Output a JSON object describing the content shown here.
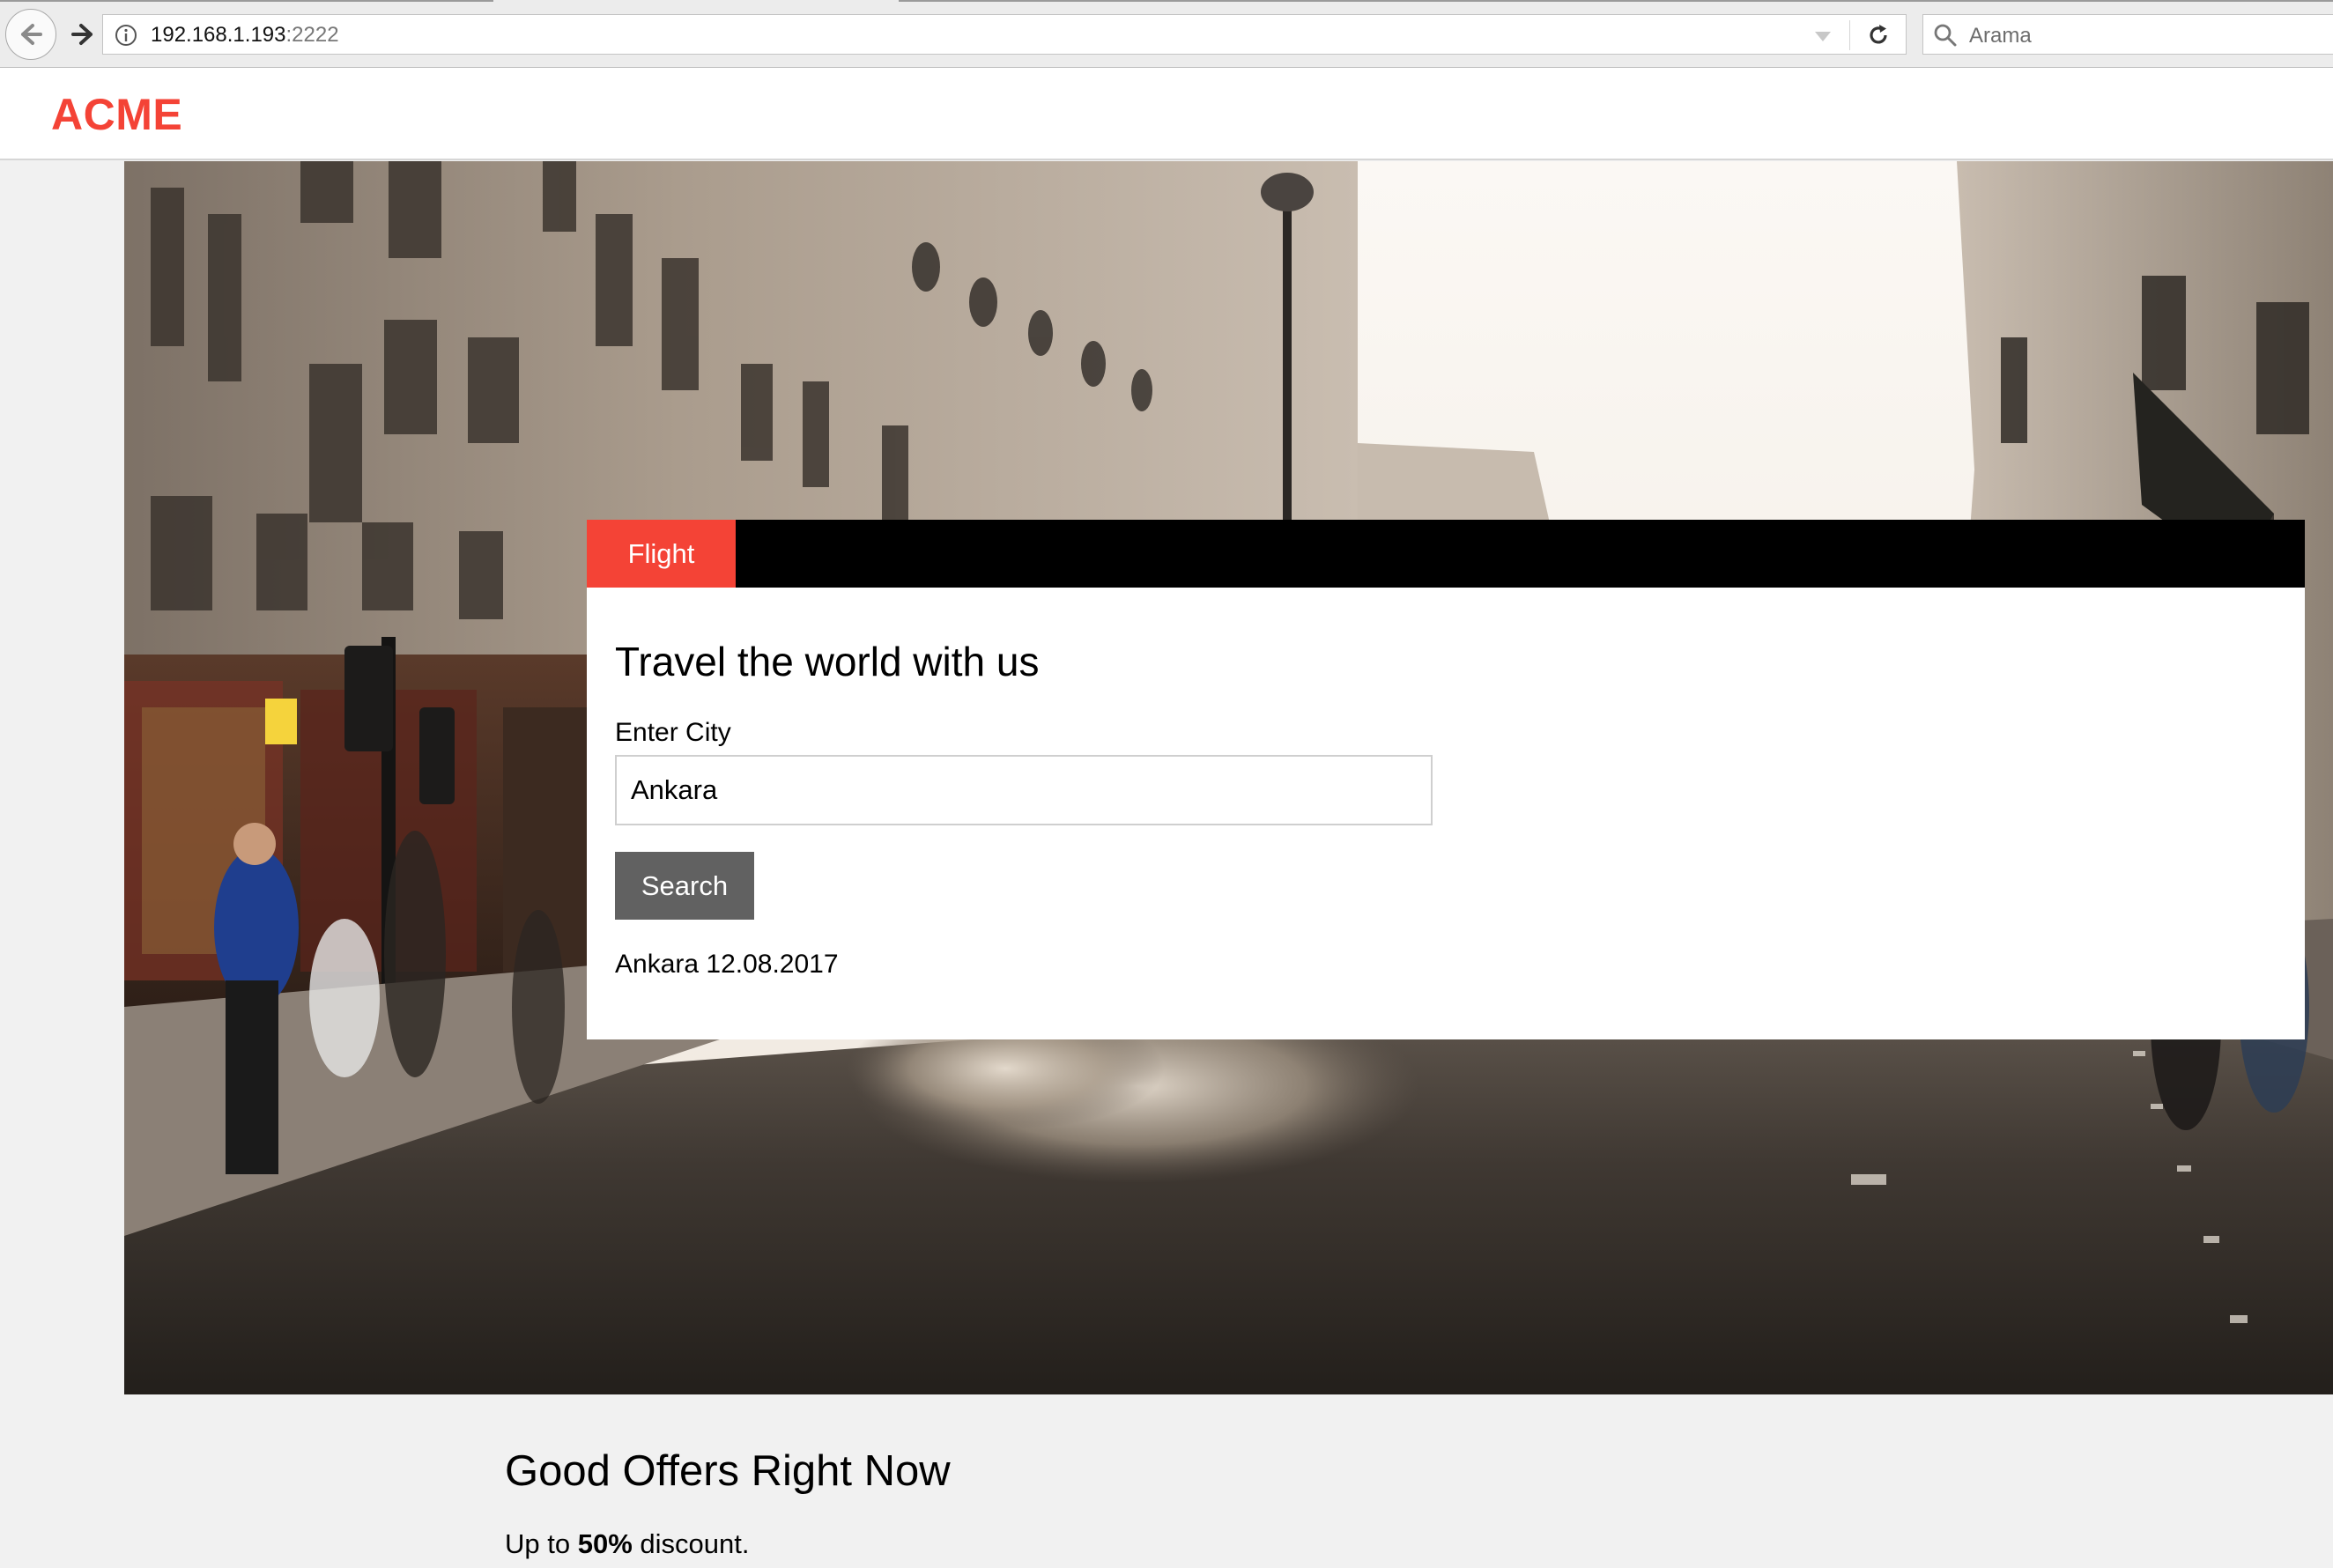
{
  "browser": {
    "url_host": "192.168.1.193",
    "url_port": ":2222",
    "search_placeholder": "Arama"
  },
  "site": {
    "logo": "ACME",
    "brand_color": "#f44336"
  },
  "booking": {
    "tabs": [
      {
        "label": "Flight",
        "active": true
      }
    ],
    "title": "Travel the world with us",
    "city_label": "Enter City",
    "city_value": "Ankara",
    "search_label": "Search",
    "result": "Ankara 12.08.2017"
  },
  "offers": {
    "title": "Good Offers Right Now",
    "text_prefix": "Up to ",
    "text_bold": "50%",
    "text_suffix": " discount."
  },
  "icons": {
    "back": "arrow-left-icon",
    "forward": "arrow-right-icon",
    "info": "info-icon",
    "dropdown": "chevron-down-icon",
    "reload": "reload-icon",
    "search": "search-icon"
  }
}
